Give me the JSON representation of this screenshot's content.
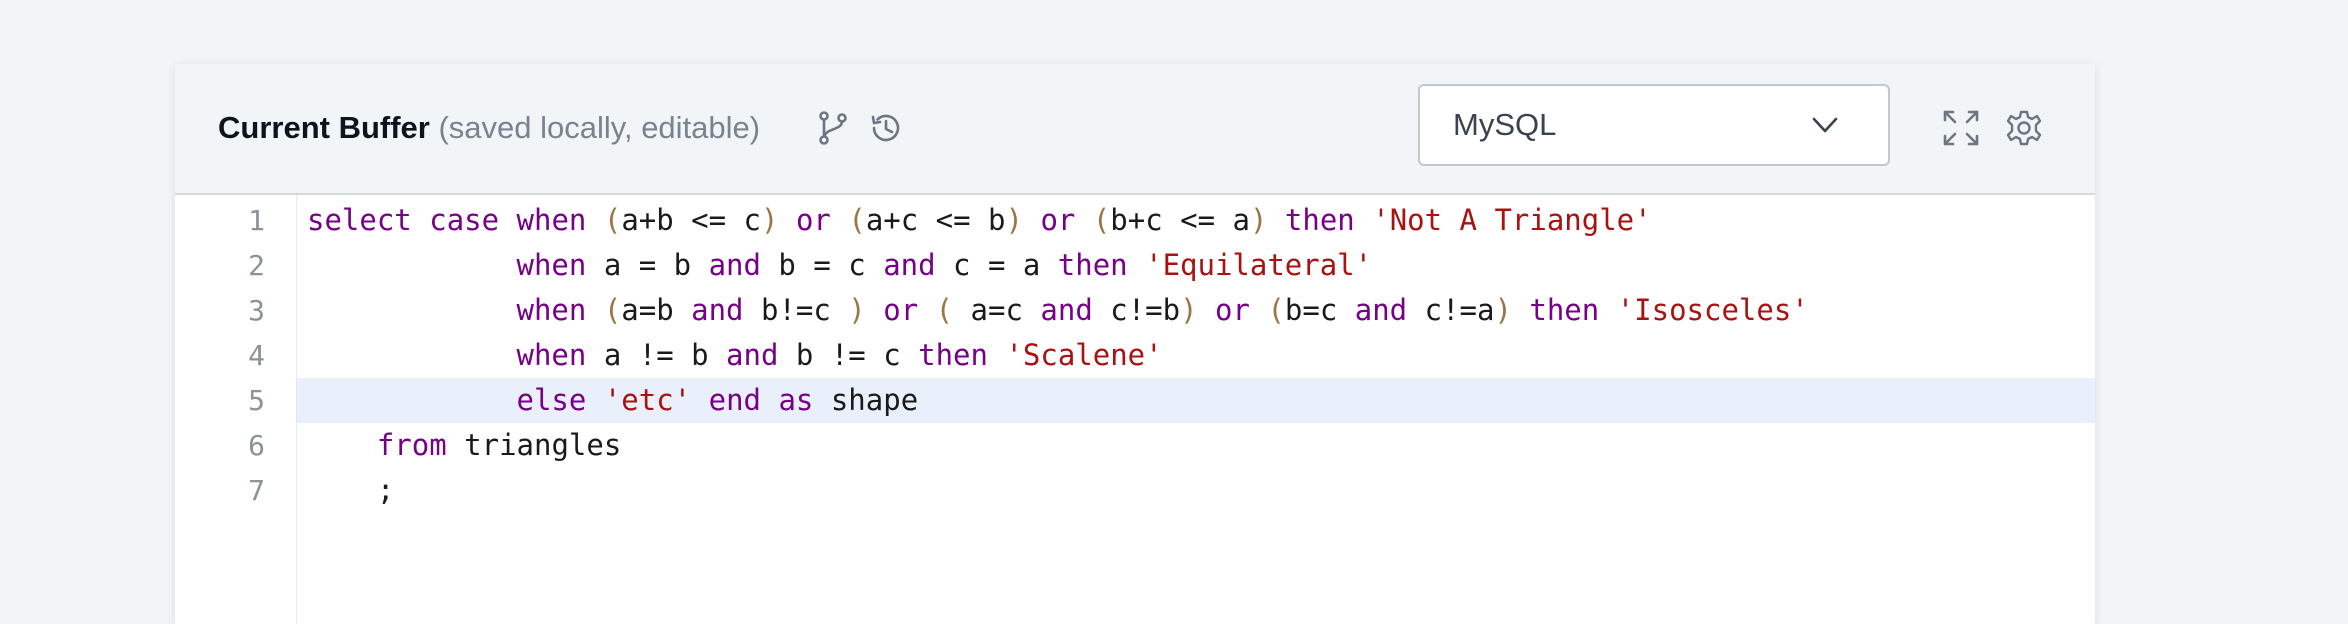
{
  "toolbar": {
    "title": "Current Buffer",
    "subtitle": "(saved locally, editable)",
    "icons": {
      "branch": "git-branch-icon",
      "history": "history-icon",
      "fullscreen": "fullscreen-icon",
      "settings": "gear-icon"
    },
    "language": {
      "selected": "MySQL"
    }
  },
  "editor": {
    "active_line": 5,
    "colors": {
      "keyword": "#770088",
      "string": "#aa1111",
      "bracket": "#997744",
      "active_line_bg": "#e9f0fb"
    },
    "lines": [
      {
        "number": "1",
        "tokens": [
          {
            "t": "kw",
            "v": "select"
          },
          {
            "t": "",
            "v": " "
          },
          {
            "t": "kw",
            "v": "case"
          },
          {
            "t": "",
            "v": " "
          },
          {
            "t": "kw",
            "v": "when"
          },
          {
            "t": "",
            "v": " "
          },
          {
            "t": "br",
            "v": "("
          },
          {
            "t": "",
            "v": "a+b <= c"
          },
          {
            "t": "br",
            "v": ")"
          },
          {
            "t": "",
            "v": " "
          },
          {
            "t": "kw",
            "v": "or"
          },
          {
            "t": "",
            "v": " "
          },
          {
            "t": "br",
            "v": "("
          },
          {
            "t": "",
            "v": "a+c <= b"
          },
          {
            "t": "br",
            "v": ")"
          },
          {
            "t": "",
            "v": " "
          },
          {
            "t": "kw",
            "v": "or"
          },
          {
            "t": "",
            "v": " "
          },
          {
            "t": "br",
            "v": "("
          },
          {
            "t": "",
            "v": "b+c <= a"
          },
          {
            "t": "br",
            "v": ")"
          },
          {
            "t": "",
            "v": " "
          },
          {
            "t": "kw",
            "v": "then"
          },
          {
            "t": "",
            "v": " "
          },
          {
            "t": "str",
            "v": "'Not A Triangle'"
          }
        ]
      },
      {
        "number": "2",
        "tokens": [
          {
            "t": "",
            "v": "            "
          },
          {
            "t": "kw",
            "v": "when"
          },
          {
            "t": "",
            "v": " a = b "
          },
          {
            "t": "kw",
            "v": "and"
          },
          {
            "t": "",
            "v": " b = c "
          },
          {
            "t": "kw",
            "v": "and"
          },
          {
            "t": "",
            "v": " c = a "
          },
          {
            "t": "kw",
            "v": "then"
          },
          {
            "t": "",
            "v": " "
          },
          {
            "t": "str",
            "v": "'Equilateral'"
          }
        ]
      },
      {
        "number": "3",
        "tokens": [
          {
            "t": "",
            "v": "            "
          },
          {
            "t": "kw",
            "v": "when"
          },
          {
            "t": "",
            "v": " "
          },
          {
            "t": "br",
            "v": "("
          },
          {
            "t": "",
            "v": "a=b "
          },
          {
            "t": "kw",
            "v": "and"
          },
          {
            "t": "",
            "v": " b!=c "
          },
          {
            "t": "br",
            "v": ")"
          },
          {
            "t": "",
            "v": " "
          },
          {
            "t": "kw",
            "v": "or"
          },
          {
            "t": "",
            "v": " "
          },
          {
            "t": "br",
            "v": "("
          },
          {
            "t": "",
            "v": " a=c "
          },
          {
            "t": "kw",
            "v": "and"
          },
          {
            "t": "",
            "v": " c!=b"
          },
          {
            "t": "br",
            "v": ")"
          },
          {
            "t": "",
            "v": " "
          },
          {
            "t": "kw",
            "v": "or"
          },
          {
            "t": "",
            "v": " "
          },
          {
            "t": "br",
            "v": "("
          },
          {
            "t": "",
            "v": "b=c "
          },
          {
            "t": "kw",
            "v": "and"
          },
          {
            "t": "",
            "v": " c!=a"
          },
          {
            "t": "br",
            "v": ")"
          },
          {
            "t": "",
            "v": " "
          },
          {
            "t": "kw",
            "v": "then"
          },
          {
            "t": "",
            "v": " "
          },
          {
            "t": "str",
            "v": "'Isosceles'"
          }
        ]
      },
      {
        "number": "4",
        "tokens": [
          {
            "t": "",
            "v": "            "
          },
          {
            "t": "kw",
            "v": "when"
          },
          {
            "t": "",
            "v": " a != b "
          },
          {
            "t": "kw",
            "v": "and"
          },
          {
            "t": "",
            "v": " b != c "
          },
          {
            "t": "kw",
            "v": "then"
          },
          {
            "t": "",
            "v": " "
          },
          {
            "t": "str",
            "v": "'Scalene'"
          }
        ]
      },
      {
        "number": "5",
        "tokens": [
          {
            "t": "",
            "v": "            "
          },
          {
            "t": "kw",
            "v": "else"
          },
          {
            "t": "",
            "v": " "
          },
          {
            "t": "str",
            "v": "'etc'"
          },
          {
            "t": "",
            "v": " "
          },
          {
            "t": "kw",
            "v": "end"
          },
          {
            "t": "",
            "v": " "
          },
          {
            "t": "kw",
            "v": "as"
          },
          {
            "t": "",
            "v": " shape"
          }
        ]
      },
      {
        "number": "6",
        "tokens": [
          {
            "t": "",
            "v": "    "
          },
          {
            "t": "kw",
            "v": "from"
          },
          {
            "t": "",
            "v": " triangles"
          }
        ]
      },
      {
        "number": "7",
        "tokens": [
          {
            "t": "",
            "v": "    ;"
          }
        ]
      }
    ]
  }
}
